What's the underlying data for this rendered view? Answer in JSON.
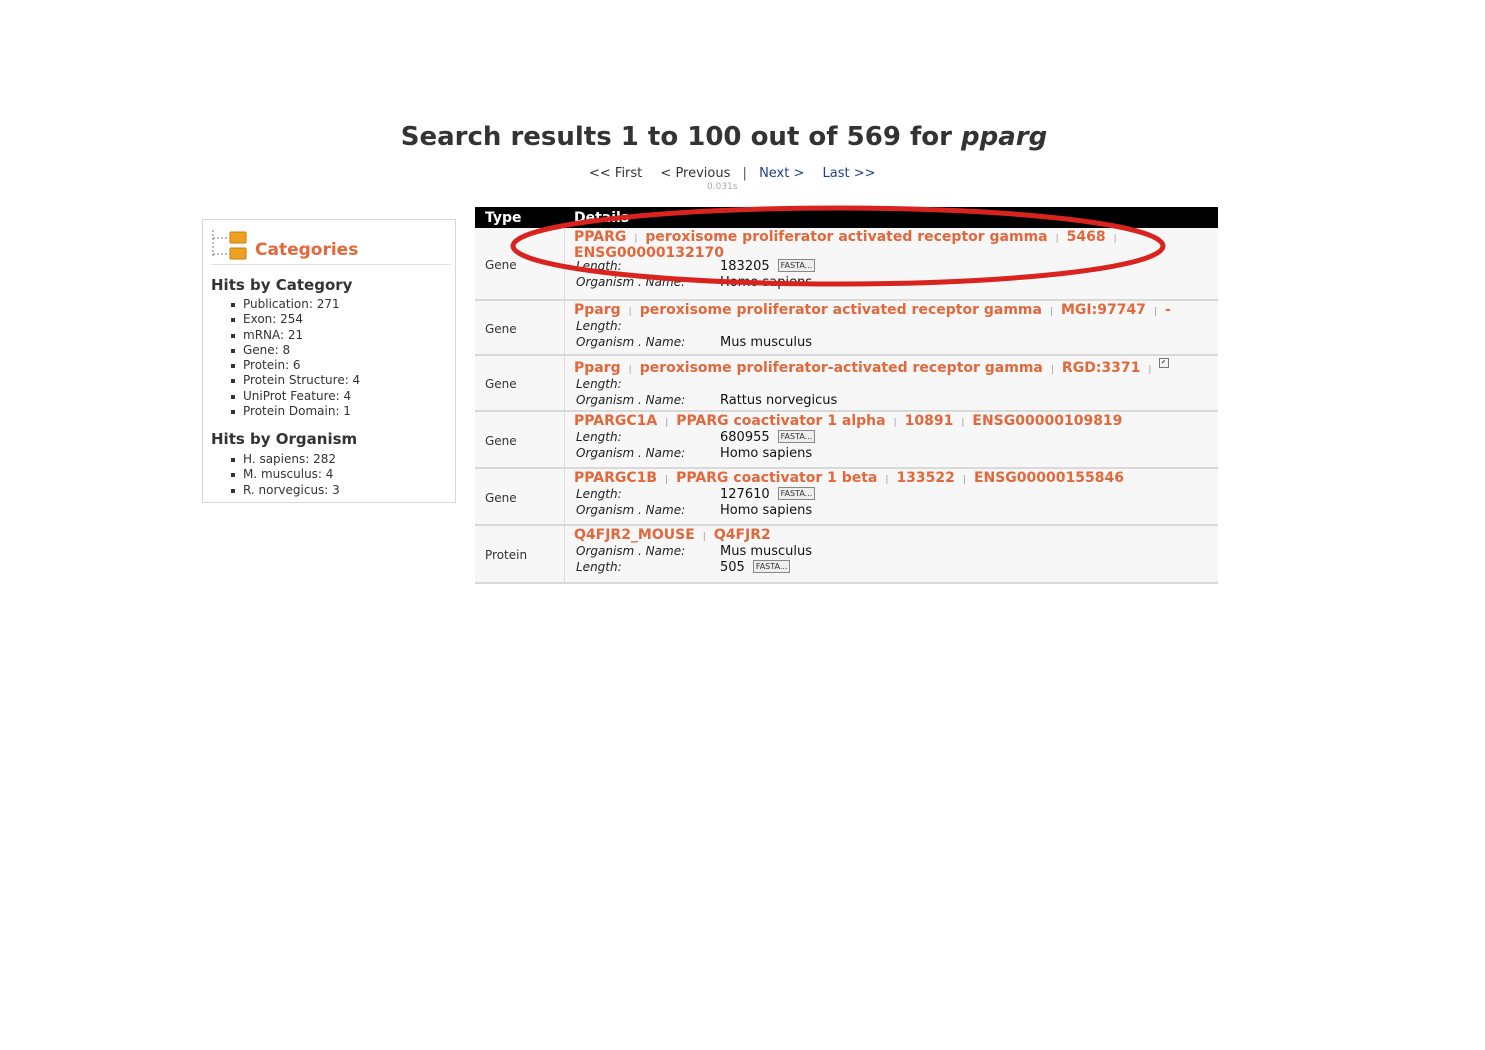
{
  "title": {
    "prefix": "Search results 1 to 100 out of 569 for",
    "query": "pparg"
  },
  "pager": {
    "first": "<< First",
    "previous": "< Previous",
    "separator": "|",
    "next": "Next >",
    "last": "Last >>",
    "timing": "0.031s"
  },
  "sidebar": {
    "title": "Categories",
    "hits_by_category": {
      "heading": "Hits by Category",
      "items": [
        "Publication: 271",
        "Exon: 254",
        "mRNA: 21",
        "Gene: 8",
        "Protein: 6",
        "Protein Structure: 4",
        "UniProt Feature: 4",
        "Protein Domain: 1"
      ]
    },
    "hits_by_organism": {
      "heading": "Hits by Organism",
      "items": [
        "H. sapiens: 282",
        "M. musculus: 4",
        "R. norvegicus: 3"
      ]
    }
  },
  "table": {
    "col_type": "Type",
    "col_details": "Details",
    "rows": [
      {
        "type": "Gene",
        "title": [
          "PPARG",
          "peroxisome proliferator activated receptor gamma",
          "5468"
        ],
        "title2": "ENSG00000132170",
        "fields": [
          {
            "label": "Length:",
            "value": "183205",
            "fasta": "FASTA..."
          },
          {
            "label": "Organism . Name:",
            "value": "Homo sapiens"
          }
        ]
      },
      {
        "type": "Gene",
        "title": [
          "Pparg",
          "peroxisome proliferator activated receptor gamma",
          "MGI:97747",
          "-"
        ],
        "fields": [
          {
            "label": "Length:",
            "value": ""
          },
          {
            "label": "Organism . Name:",
            "value": "Mus musculus"
          }
        ]
      },
      {
        "type": "Gene",
        "title": [
          "Pparg",
          "peroxisome proliferator-activated receptor gamma",
          "RGD:3371"
        ],
        "external_icon": "external-link-icon",
        "fields": [
          {
            "label": "Length:",
            "value": ""
          },
          {
            "label": "Organism . Name:",
            "value": "Rattus norvegicus"
          }
        ]
      },
      {
        "type": "Gene",
        "title": [
          "PPARGC1A",
          "PPARG coactivator 1 alpha",
          "10891",
          "ENSG00000109819"
        ],
        "fields": [
          {
            "label": "Length:",
            "value": "680955",
            "fasta": "FASTA..."
          },
          {
            "label": "Organism . Name:",
            "value": "Homo sapiens"
          }
        ]
      },
      {
        "type": "Gene",
        "title": [
          "PPARGC1B",
          "PPARG coactivator 1 beta",
          "133522",
          "ENSG00000155846"
        ],
        "fields": [
          {
            "label": "Length:",
            "value": "127610",
            "fasta": "FASTA..."
          },
          {
            "label": "Organism . Name:",
            "value": "Homo sapiens"
          }
        ]
      },
      {
        "type": "Protein",
        "title": [
          "Q4FJR2_MOUSE",
          "Q4FJR2"
        ],
        "fields": [
          {
            "label": "Organism . Name:",
            "value": "Mus musculus"
          },
          {
            "label": "Length:",
            "value": "505",
            "fasta": "FASTA..."
          }
        ]
      }
    ]
  },
  "colors": {
    "accent": "#e2683c",
    "link": "#1b3f8b",
    "annotation": "#d9231f",
    "header_bg": "#000000"
  }
}
